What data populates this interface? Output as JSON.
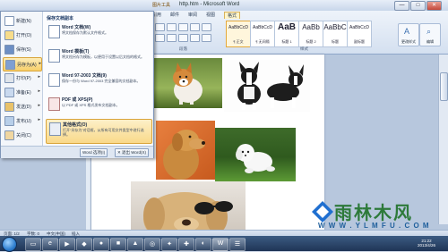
{
  "window": {
    "title": "http.htm - Microsoft Word",
    "tool_tab": "图片工具",
    "controls": {
      "minimize": "—",
      "maximize": "□",
      "close": "✕"
    }
  },
  "ribbon": {
    "tabs": [
      "引用",
      "邮件",
      "审阅",
      "视图",
      "格式"
    ],
    "styles": [
      {
        "sample": "AaBbCcD",
        "name": "¶ 正文",
        "selected": true
      },
      {
        "sample": "AaBbCcD",
        "name": "¶ 无间隔",
        "selected": false
      },
      {
        "sample": "AaB",
        "name": "标题 1",
        "selected": false
      },
      {
        "sample": "AaBb",
        "name": "标题 2",
        "selected": false
      },
      {
        "sample": "AaBbC",
        "name": "标题",
        "selected": false
      },
      {
        "sample": "AaBbCcD",
        "name": "副标题",
        "selected": false
      }
    ],
    "buttons": {
      "change_styles": "更改样式",
      "edit": "编辑"
    },
    "group_labels": {
      "paragraph": "段落",
      "styles": "样式"
    }
  },
  "office_menu": {
    "left_items": [
      {
        "label": "新建(N)",
        "icon": "new-doc-icon",
        "active": false,
        "has_arrow": false
      },
      {
        "label": "打开(O)",
        "icon": "open-folder-icon",
        "active": false,
        "has_arrow": false
      },
      {
        "label": "保存(S)",
        "icon": "save-icon",
        "active": false,
        "has_arrow": false
      },
      {
        "label": "另存为(A)",
        "icon": "save-as-icon",
        "active": true,
        "has_arrow": true
      },
      {
        "label": "打印(P)",
        "icon": "print-icon",
        "active": false,
        "has_arrow": true
      },
      {
        "label": "准备(E)",
        "icon": "prepare-icon",
        "active": false,
        "has_arrow": true
      },
      {
        "label": "发送(D)",
        "icon": "send-icon",
        "active": false,
        "has_arrow": true
      },
      {
        "label": "发布(U)",
        "icon": "publish-icon",
        "active": false,
        "has_arrow": true
      },
      {
        "label": "关闭(C)",
        "icon": "close-doc-icon",
        "active": false,
        "has_arrow": false
      }
    ],
    "right_header": "保存文档副本",
    "save_options": [
      {
        "title": "Word 文档(W)",
        "desc": "将文档保存为默认文件格式。",
        "icon": "word-doc-icon",
        "active": false
      },
      {
        "title": "Word 模板(T)",
        "desc": "将文档另存为模板，以便用于设置以后文档的格式。",
        "icon": "word-template-icon",
        "active": false
      },
      {
        "title": "Word 97-2003 文档(9)",
        "desc": "保存一份与 Word 97-2003 完全兼容的文档副本。",
        "icon": "word-97-icon",
        "active": false
      },
      {
        "title": "PDF 或 XPS(P)",
        "desc": "以 PDF 或 XPS 格式发布文档副本。",
        "icon": "pdf-icon",
        "active": false
      },
      {
        "title": "其他格式(O)",
        "desc": "打开“另存为”对话框，从所有可用文件类型中进行选择。",
        "icon": "other-formats-icon",
        "active": true
      }
    ],
    "bottom_buttons": [
      "Word 选项(I)",
      "✕ 退出 Word(X)"
    ]
  },
  "statusbar": {
    "page": "页面: 1/2",
    "words": "字数: 0",
    "language": "中文(中国)",
    "mode": "插入"
  },
  "taskbar": {
    "clock_time": "21:22",
    "clock_date": "2013/4/26"
  },
  "watermark": {
    "text": "雨林木风",
    "url": "W W W . Y L M F U . C O M"
  }
}
